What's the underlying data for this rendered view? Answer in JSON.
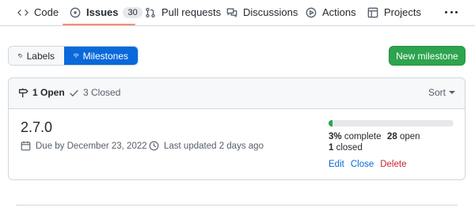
{
  "nav": {
    "items": [
      {
        "label": "Code",
        "icon": "code-icon"
      },
      {
        "label": "Issues",
        "icon": "issue-opened-icon",
        "count": "30",
        "active": true
      },
      {
        "label": "Pull requests",
        "icon": "git-pull-request-icon"
      },
      {
        "label": "Discussions",
        "icon": "comment-discussion-icon"
      },
      {
        "label": "Actions",
        "icon": "play-icon"
      },
      {
        "label": "Projects",
        "icon": "table-icon"
      }
    ],
    "more_icon": "kebab-horizontal-icon",
    "active_underline_color": "#fd8c73"
  },
  "toolbar": {
    "labels_label": "Labels",
    "milestones_label": "Milestones",
    "new_milestone_label": "New milestone"
  },
  "milestones_header": {
    "open_label": "1 Open",
    "closed_label": "3 Closed",
    "sort_label": "Sort"
  },
  "milestone": {
    "title": "2.7.0",
    "due": "Due by December 23, 2022",
    "updated": "Last updated 2 days ago",
    "progress_fraction": 0.03,
    "percent": "3%",
    "percent_suffix": " complete",
    "open_count": "28",
    "open_suffix": " open",
    "closed_count": "1",
    "closed_suffix": " closed",
    "edit_label": "Edit",
    "close_label": "Close",
    "delete_label": "Delete"
  },
  "colors": {
    "accent_blue": "#0969da",
    "success_green": "#2da44e",
    "danger_red": "#cf222e"
  }
}
